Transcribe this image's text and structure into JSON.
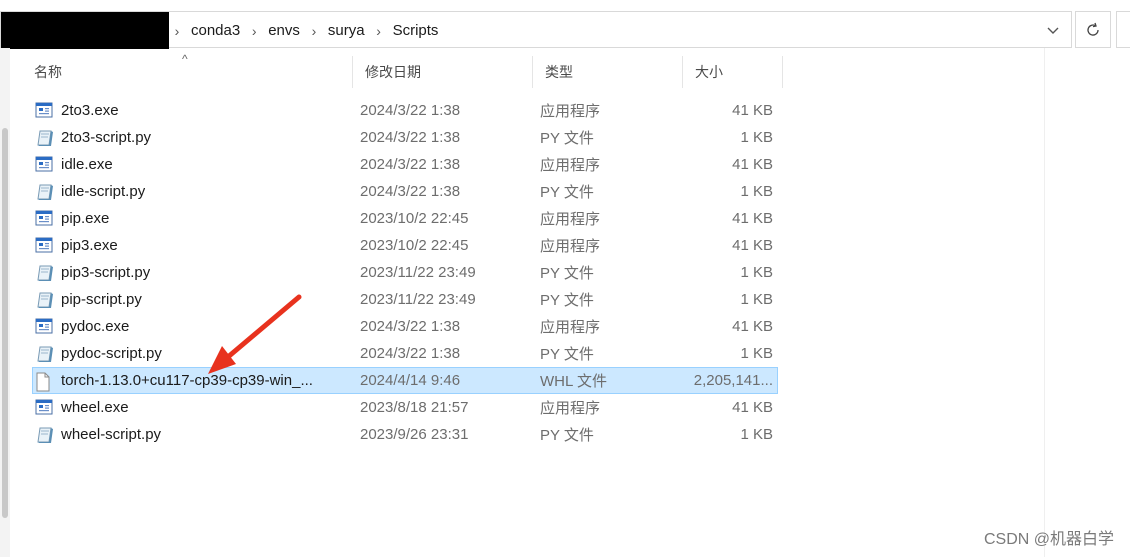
{
  "address_bar": {
    "crumbs": [
      "conda3",
      "envs",
      "surya",
      "Scripts"
    ]
  },
  "columns": {
    "name": "名称",
    "date": "修改日期",
    "type": "类型",
    "size": "大小"
  },
  "files": [
    {
      "name": "2to3.exe",
      "date": "2024/3/22 1:38",
      "type": "应用程序",
      "size": "41 KB",
      "icon": "exe-icon"
    },
    {
      "name": "2to3-script.py",
      "date": "2024/3/22 1:38",
      "type": "PY 文件",
      "size": "1 KB",
      "icon": "py-file-icon"
    },
    {
      "name": "idle.exe",
      "date": "2024/3/22 1:38",
      "type": "应用程序",
      "size": "41 KB",
      "icon": "exe-icon"
    },
    {
      "name": "idle-script.py",
      "date": "2024/3/22 1:38",
      "type": "PY 文件",
      "size": "1 KB",
      "icon": "py-file-icon"
    },
    {
      "name": "pip.exe",
      "date": "2023/10/2 22:45",
      "type": "应用程序",
      "size": "41 KB",
      "icon": "exe-icon"
    },
    {
      "name": "pip3.exe",
      "date": "2023/10/2 22:45",
      "type": "应用程序",
      "size": "41 KB",
      "icon": "exe-icon"
    },
    {
      "name": "pip3-script.py",
      "date": "2023/11/22 23:49",
      "type": "PY 文件",
      "size": "1 KB",
      "icon": "py-file-icon"
    },
    {
      "name": "pip-script.py",
      "date": "2023/11/22 23:49",
      "type": "PY 文件",
      "size": "1 KB",
      "icon": "py-file-icon"
    },
    {
      "name": "pydoc.exe",
      "date": "2024/3/22 1:38",
      "type": "应用程序",
      "size": "41 KB",
      "icon": "exe-icon"
    },
    {
      "name": "pydoc-script.py",
      "date": "2024/3/22 1:38",
      "type": "PY 文件",
      "size": "1 KB",
      "icon": "py-file-icon"
    },
    {
      "name": "torch-1.13.0+cu117-cp39-cp39-win_...",
      "date": "2024/4/14 9:46",
      "type": "WHL 文件",
      "size": "2,205,141...",
      "icon": "blank-file-icon",
      "selected": true
    },
    {
      "name": "wheel.exe",
      "date": "2023/8/18 21:57",
      "type": "应用程序",
      "size": "41 KB",
      "icon": "exe-icon"
    },
    {
      "name": "wheel-script.py",
      "date": "2023/9/26 23:31",
      "type": "PY 文件",
      "size": "1 KB",
      "icon": "py-file-icon"
    }
  ],
  "watermark": "CSDN @机器白学",
  "colors": {
    "selection_bg": "#cce8ff",
    "selection_border": "#99d1ff",
    "annotation_arrow": "#e8321e"
  }
}
